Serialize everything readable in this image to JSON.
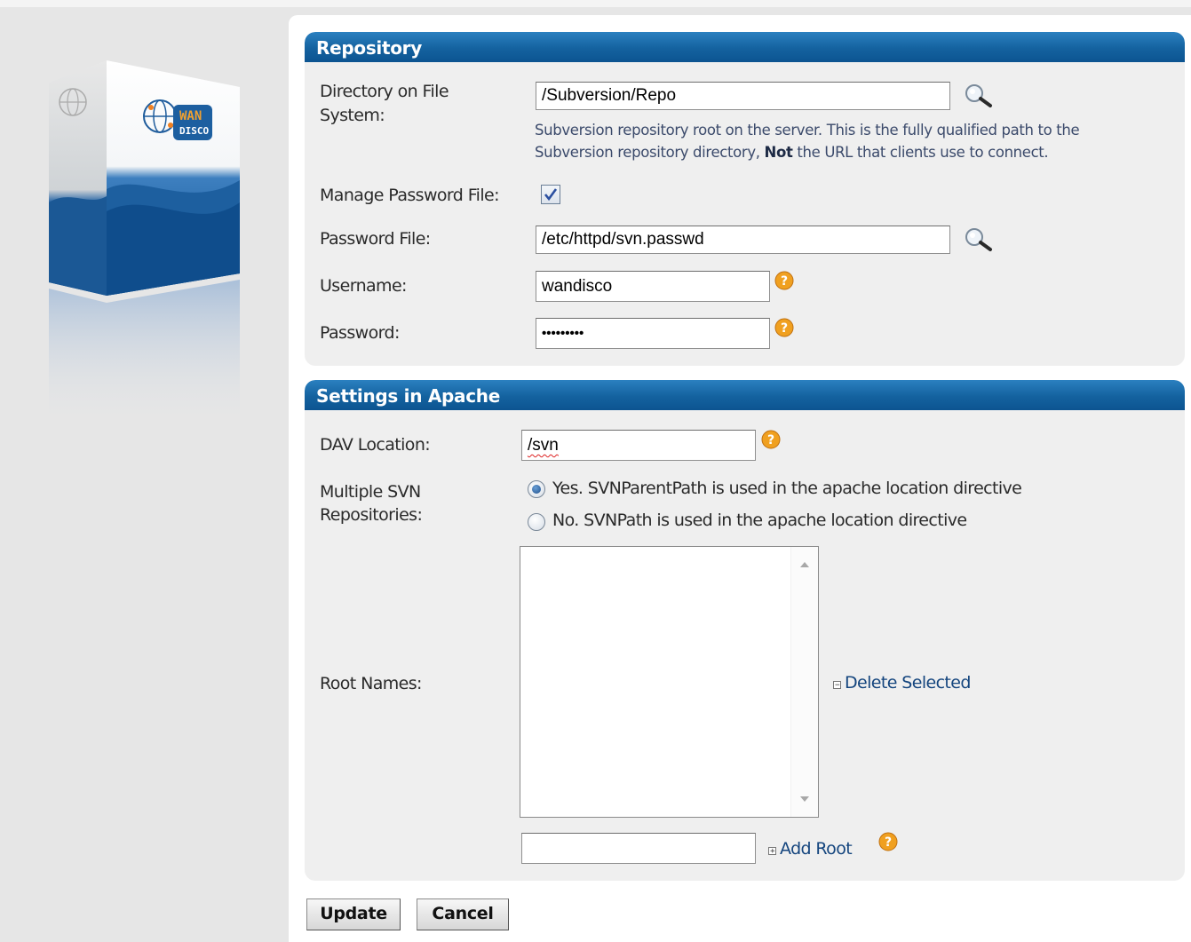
{
  "repository": {
    "header": "Repository",
    "directory_label_1": "Directory on File",
    "directory_label_2": "System:",
    "directory_value": "/Subversion/Repo",
    "directory_hint_1": "Subversion repository root on the server. This is the fully qualified path to the",
    "directory_hint_2a": "Subversion repository directory,",
    "directory_hint_2b": "Not",
    "directory_hint_2c": "the URL that clients use to connect.",
    "manage_password_label": "Manage Password File:",
    "manage_password_checked": true,
    "password_file_label": "Password File:",
    "password_file_value": "/etc/httpd/svn.passwd",
    "username_label": "Username:",
    "username_value": "wandisco",
    "password_label": "Password:",
    "password_value": "•••••••••"
  },
  "apache": {
    "header": "Settings in Apache",
    "dav_label": "DAV Location:",
    "dav_value": "/svn",
    "multiple_label_1": "Multiple SVN",
    "multiple_label_2": "Repositories:",
    "option_yes": "Yes. SVNParentPath is used in the apache location directive",
    "option_no": "No. SVNPath is used in the apache location directive",
    "selected_option": "yes",
    "root_names_label": "Root Names:",
    "root_names_items": [],
    "delete_selected": "Delete Selected",
    "add_root_value": "",
    "add_root": "Add Root"
  },
  "buttons": {
    "update": "Update",
    "cancel": "Cancel"
  },
  "logo": {
    "brand_line_1": "WAN",
    "brand_line_2": "DISCO"
  },
  "colors": {
    "header_blue": "#14629f",
    "panel_bg": "#efefef",
    "help_orange": "#f0a020"
  }
}
